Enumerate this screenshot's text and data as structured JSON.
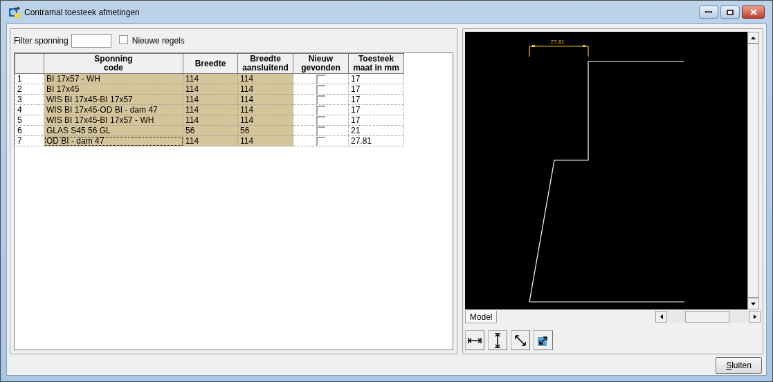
{
  "window": {
    "title": "Contramal toesteek afmetingen"
  },
  "filter": {
    "label": "Filter sponning"
  },
  "new_rows_checkbox": {
    "label": "Nieuwe regels",
    "checked": false
  },
  "table": {
    "columns": [
      "Sponning\ncode",
      "Breedte",
      "Breedte\naansluitend",
      "Nieuw\ngevonden",
      "Toesteek\nmaat in mm"
    ],
    "rows": [
      {
        "number": "1",
        "code": "BI 17x57 - WH",
        "breedte": "114",
        "aansluitend": "114",
        "nieuw_gevonden": false,
        "toesteek": "17",
        "selected": false
      },
      {
        "number": "2",
        "code": "BI 17x45",
        "breedte": "114",
        "aansluitend": "114",
        "nieuw_gevonden": false,
        "toesteek": "17",
        "selected": false
      },
      {
        "number": "3",
        "code": "WIS BI 17x45-BI 17x57",
        "breedte": "114",
        "aansluitend": "114",
        "nieuw_gevonden": false,
        "toesteek": "17",
        "selected": false
      },
      {
        "number": "4",
        "code": "WIS BI 17x45-OD BI - dam 47",
        "breedte": "114",
        "aansluitend": "114",
        "nieuw_gevonden": false,
        "toesteek": "17",
        "selected": false
      },
      {
        "number": "5",
        "code": "WIS BI 17x45-BI 17x57 - WH",
        "breedte": "114",
        "aansluitend": "114",
        "nieuw_gevonden": false,
        "toesteek": "17",
        "selected": false
      },
      {
        "number": "6",
        "code": "GLAS S45 56 GL",
        "breedte": "56",
        "aansluitend": "56",
        "nieuw_gevonden": false,
        "toesteek": "21",
        "selected": false
      },
      {
        "number": "7",
        "code": "OD BI - dam 47",
        "breedte": "114",
        "aansluitend": "114",
        "nieuw_gevonden": false,
        "toesteek": "27.81",
        "selected": true
      }
    ]
  },
  "drawing": {
    "dimension_label": "27.81",
    "tabs": [
      {
        "label": "Model",
        "selected": true
      }
    ]
  },
  "buttons": [
    "Sluiten"
  ]
}
